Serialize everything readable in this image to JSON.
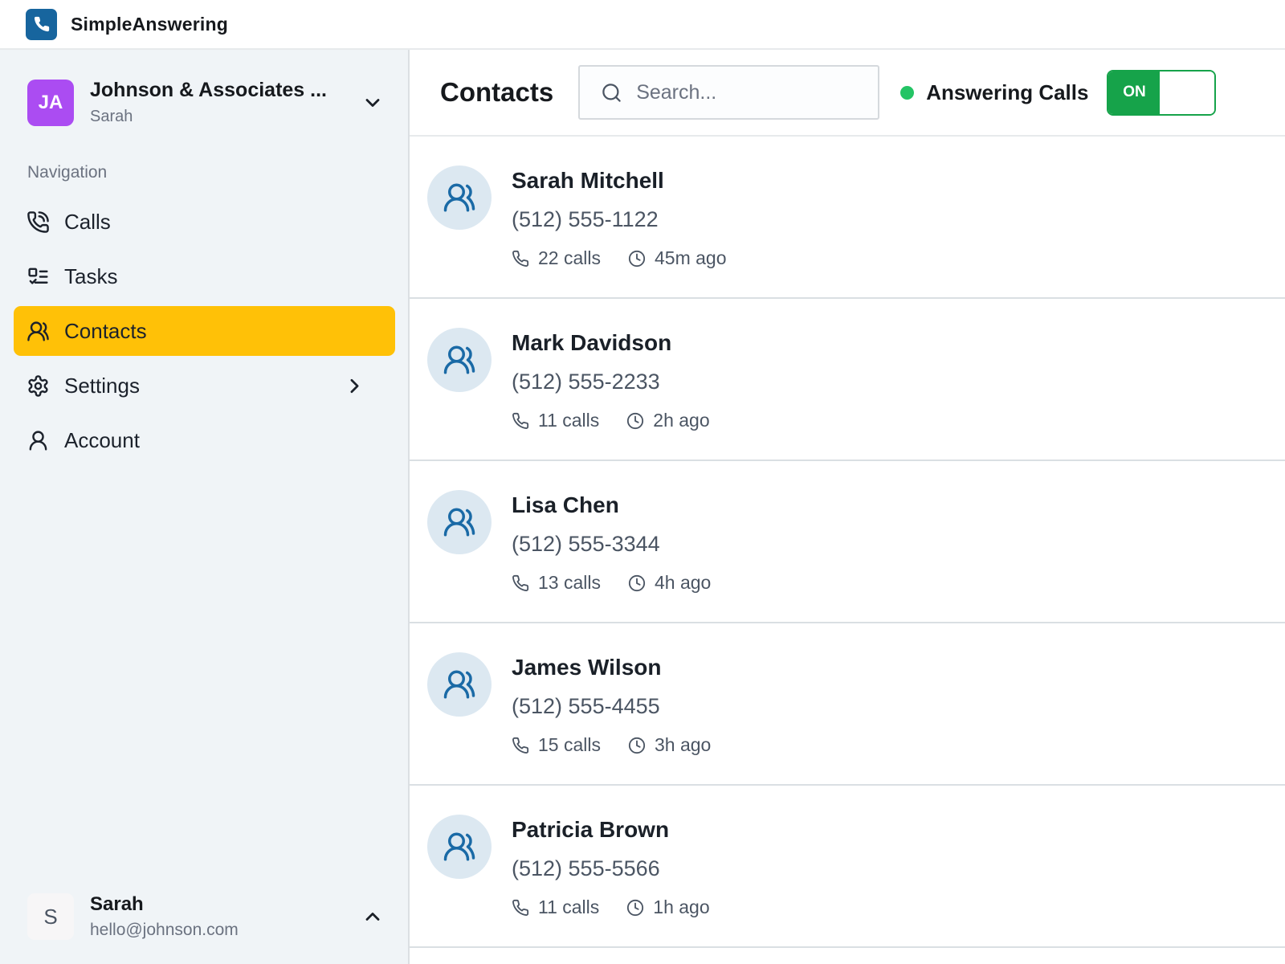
{
  "topbar": {
    "app_name": "SimpleAnswering"
  },
  "sidebar": {
    "workspace": {
      "initials": "JA",
      "name": "Johnson & Associates ...",
      "subtitle": "Sarah"
    },
    "nav_label": "Navigation",
    "items": [
      {
        "label": "Calls"
      },
      {
        "label": "Tasks"
      },
      {
        "label": "Contacts",
        "active": true
      },
      {
        "label": "Settings"
      },
      {
        "label": "Account"
      }
    ],
    "user": {
      "initial": "S",
      "name": "Sarah",
      "email": "hello@johnson.com"
    }
  },
  "main": {
    "title": "Contacts",
    "search": {
      "placeholder": "Search..."
    },
    "status": {
      "label": "Answering Calls",
      "toggle_label": "ON",
      "state": "on"
    },
    "contacts": [
      {
        "name": "Sarah Mitchell",
        "phone": "(512) 555-1122",
        "calls": "22 calls",
        "last_call": "45m ago"
      },
      {
        "name": "Mark Davidson",
        "phone": "(512) 555-2233",
        "calls": "11 calls",
        "last_call": "2h ago"
      },
      {
        "name": "Lisa Chen",
        "phone": "(512) 555-3344",
        "calls": "13 calls",
        "last_call": "4h ago"
      },
      {
        "name": "James Wilson",
        "phone": "(512) 555-4455",
        "calls": "15 calls",
        "last_call": "3h ago"
      },
      {
        "name": "Patricia Brown",
        "phone": "(512) 555-5566",
        "calls": "11 calls",
        "last_call": "1h ago"
      }
    ]
  },
  "colors": {
    "accent_yellow": "#ffc107",
    "brand_blue": "#17659e",
    "workspace_purple": "#ab4cf2",
    "toggle_green": "#16a34a",
    "status_dot_green": "#24c465",
    "contact_avatar_blue": "#1a6aa6"
  }
}
